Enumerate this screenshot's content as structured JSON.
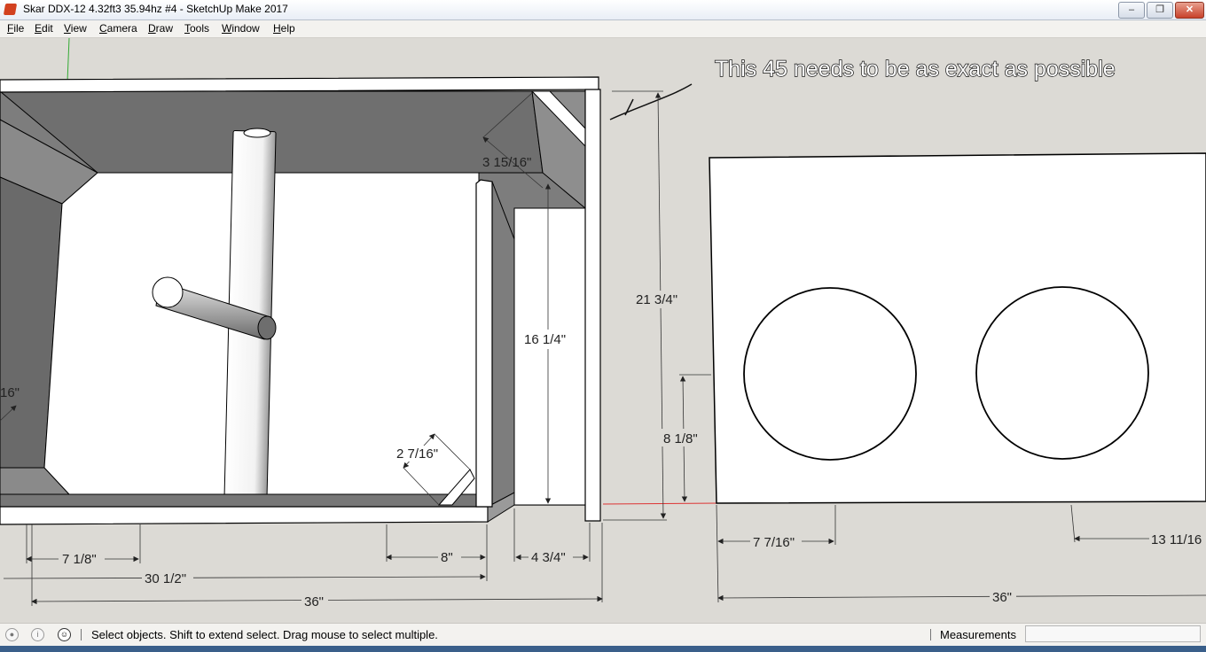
{
  "window": {
    "title": "Skar DDX-12 4.32ft3 35.94hz #4 - SketchUp Make 2017",
    "minimize_glyph": "–",
    "maximize_glyph": "❐",
    "close_glyph": "✕"
  },
  "menu": {
    "items": [
      {
        "first": "F",
        "rest": "ile"
      },
      {
        "first": "E",
        "rest": "dit"
      },
      {
        "first": "V",
        "rest": "iew"
      },
      {
        "first": "C",
        "rest": "amera"
      },
      {
        "first": "D",
        "rest": "raw"
      },
      {
        "first": "T",
        "rest": "ools"
      },
      {
        "first": "W",
        "rest": "indow"
      },
      {
        "first": "H",
        "rest": "elp"
      }
    ]
  },
  "model": {
    "annotation": "This 45 needs to be as exact as possible",
    "dimensions": {
      "miter_width": "3 15/16\"",
      "divider_height": "16 1/4\"",
      "overall_height": "21 3/4\"",
      "left_partial": "16\"",
      "brace_width": "2 7/16\"",
      "port_left": "7 1/8\"",
      "inner_length": "30 1/2\"",
      "chamber_8": "8\"",
      "port_width": "4 3/4\"",
      "overall_length": "36\"",
      "baffle_height": "36\"",
      "hole_center_height": "8 1/8\"",
      "hole_offset_left": "7 7/16\"",
      "hole_offset_right": "13 11/16"
    }
  },
  "status": {
    "message": "Select objects. Shift to extend select. Drag mouse to select multiple.",
    "measurements_label": "Measurements",
    "measurements_value": ""
  },
  "colors": {
    "background": "#dcdad5",
    "panel_shade": "#7f7f7f",
    "panel_face": "#ffffff",
    "axis_red": "#d33",
    "axis_green": "#3a3"
  }
}
